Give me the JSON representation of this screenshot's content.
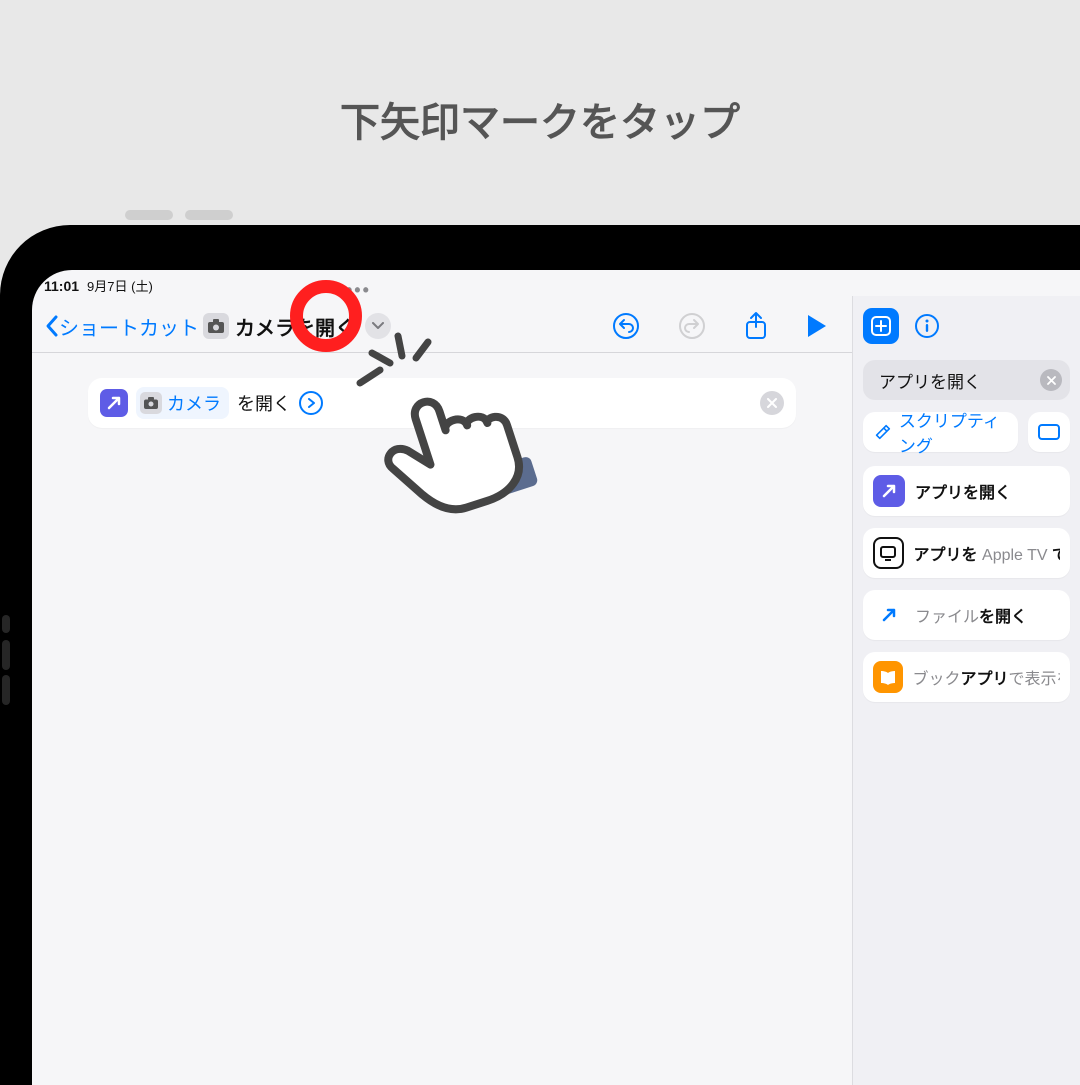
{
  "page": {
    "title": "下矢印マークをタップ"
  },
  "status": {
    "time": "11:01",
    "date": "9月7日 (土)"
  },
  "nav": {
    "back_label": "ショートカット",
    "shortcut_title": "カメラを開く"
  },
  "toolbar": {
    "undo": "undo",
    "redo": "redo",
    "share": "share",
    "play": "play"
  },
  "action_row": {
    "app_label": "カメラ",
    "open_label": "を開く"
  },
  "sidebar": {
    "search_value": "アプリを開く",
    "filter_scripting": "スクリプティング",
    "items": [
      {
        "html": "<b>アプリを開く</b>"
      },
      {
        "html": "<b>アプリを</b> <span class='gray'>Apple TV</span> <b>で</b>"
      },
      {
        "html": "<span class='gray'>ファイル</span><b>を開く</b>"
      },
      {
        "html": "<span class='gray'>ブック</span><b>アプリ</b><span class='gray'>で表示を</span>"
      }
    ]
  }
}
